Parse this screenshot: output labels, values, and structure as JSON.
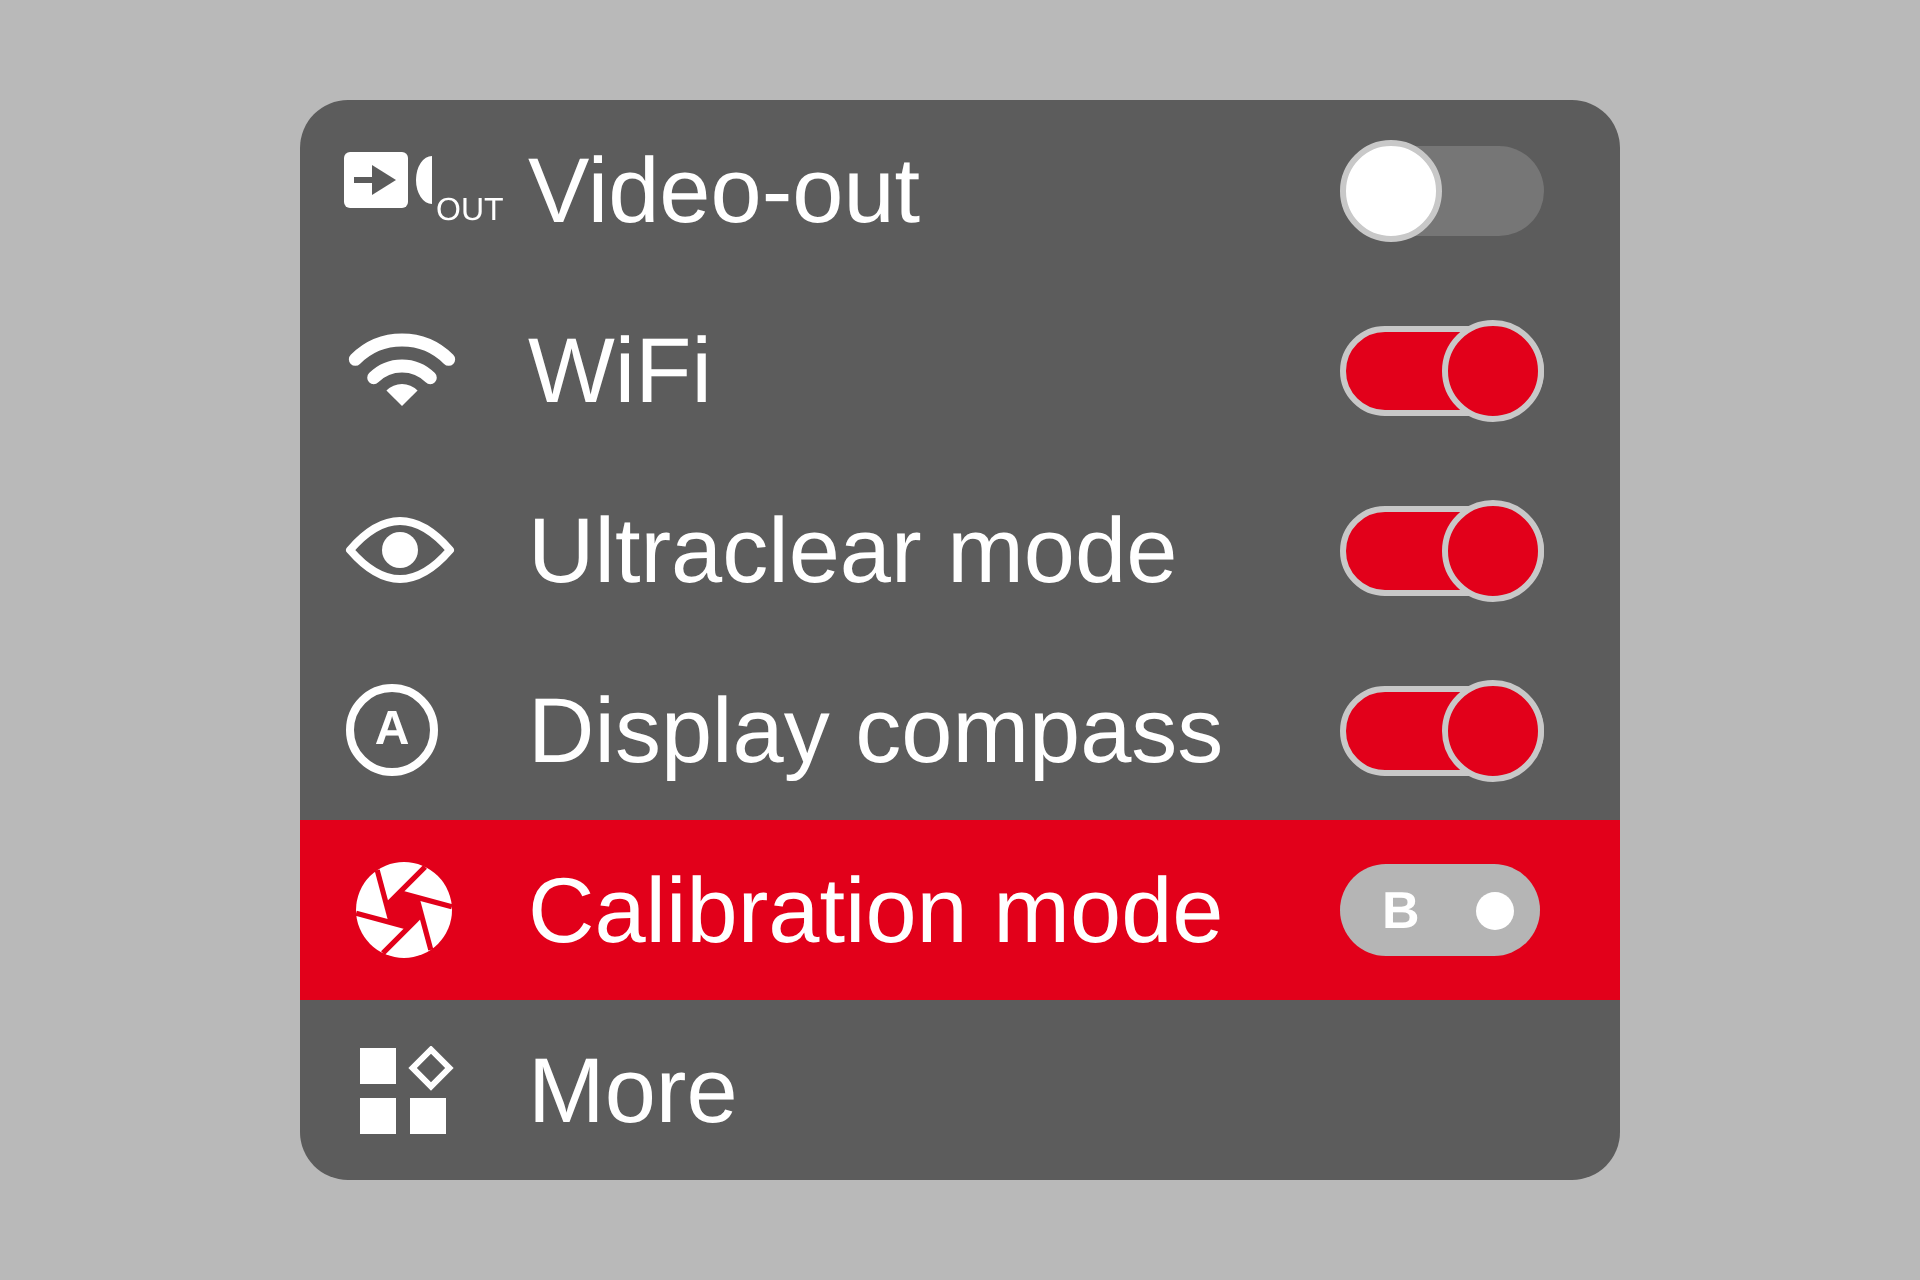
{
  "menu": {
    "items": [
      {
        "label": "Video-out",
        "icon_text": "OUT",
        "selected": false,
        "control": {
          "kind": "switch",
          "on": false
        }
      },
      {
        "label": "WiFi",
        "selected": false,
        "control": {
          "kind": "switch",
          "on": true
        }
      },
      {
        "label": "Ultraclear mode",
        "selected": false,
        "control": {
          "kind": "switch",
          "on": true
        }
      },
      {
        "label": "Display compass",
        "icon_text": "A",
        "selected": false,
        "control": {
          "kind": "switch",
          "on": true
        }
      },
      {
        "label": "Calibration mode",
        "selected": true,
        "control": {
          "kind": "mode",
          "value": "B"
        }
      },
      {
        "label": "More",
        "selected": false
      }
    ]
  }
}
